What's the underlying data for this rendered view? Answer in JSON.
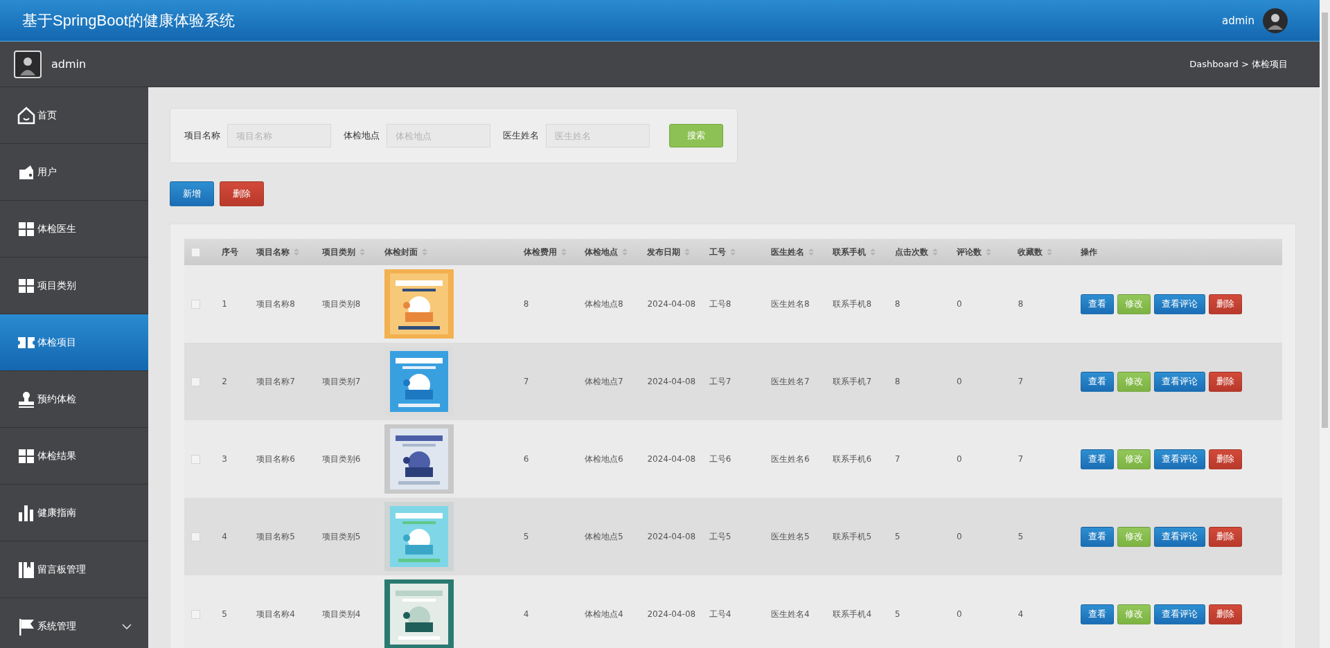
{
  "header": {
    "title": "基于SpringBoot的健康体验系统",
    "user": "admin"
  },
  "subheader": {
    "user": "admin",
    "breadcrumb": "Dashboard > 体检项目"
  },
  "sidebar": {
    "items": [
      {
        "label": "首页",
        "selected": false
      },
      {
        "label": "用户",
        "selected": false
      },
      {
        "label": "体检医生",
        "selected": false
      },
      {
        "label": "项目类别",
        "selected": false
      },
      {
        "label": "体检项目",
        "selected": true
      },
      {
        "label": "预约体检",
        "selected": false
      },
      {
        "label": "体检结果",
        "selected": false
      },
      {
        "label": "健康指南",
        "selected": false
      },
      {
        "label": "留言板管理",
        "selected": false
      },
      {
        "label": "系统管理",
        "selected": false,
        "expanded": false
      }
    ]
  },
  "search": {
    "fields": [
      {
        "label": "项目名称",
        "placeholder": "项目名称"
      },
      {
        "label": "体检地点",
        "placeholder": "体检地点"
      },
      {
        "label": "医生姓名",
        "placeholder": "医生姓名"
      }
    ],
    "button": "搜索"
  },
  "toolbar": [
    {
      "label": "新增",
      "kind": "primary"
    },
    {
      "label": "删除",
      "kind": "danger"
    }
  ],
  "table": {
    "select_all": {
      "checked": false
    },
    "columns": [
      {
        "label": "序号",
        "sortable": false
      },
      {
        "label": "项目名称",
        "sortable": true
      },
      {
        "label": "项目类别",
        "sortable": true
      },
      {
        "label": "体检封面",
        "sortable": true
      },
      {
        "label": "体检费用",
        "sortable": true
      },
      {
        "label": "体检地点",
        "sortable": true
      },
      {
        "label": "发布日期",
        "sortable": true
      },
      {
        "label": "工号",
        "sortable": true
      },
      {
        "label": "医生姓名",
        "sortable": true
      },
      {
        "label": "联系手机",
        "sortable": true
      },
      {
        "label": "点击次数",
        "sortable": true
      },
      {
        "label": "评论数",
        "sortable": true
      },
      {
        "label": "收藏数",
        "sortable": true
      },
      {
        "label": "操作",
        "sortable": false
      }
    ],
    "rows": [
      {
        "checked": false,
        "cells": [
          "1",
          "项目名称8",
          "项目类别8",
          {
            "kind": "picture"
          },
          "8",
          "体检地点8",
          "2024-04-08",
          "工号8",
          "医生姓名8",
          "联系手机8",
          "8",
          "0",
          "8"
        ],
        "actions": [
          {
            "label": "查看",
            "kind": "primary"
          },
          {
            "label": "修改",
            "kind": "success"
          },
          {
            "label": "查看评论",
            "kind": "primary"
          },
          {
            "label": "删除",
            "kind": "danger"
          }
        ]
      },
      {
        "checked": false,
        "cells": [
          "2",
          "项目名称7",
          "项目类别7",
          {
            "kind": "picture"
          },
          "7",
          "体检地点7",
          "2024-04-08",
          "工号7",
          "医生姓名7",
          "联系手机7",
          "8",
          "0",
          "7"
        ],
        "actions": [
          {
            "label": "查看",
            "kind": "primary"
          },
          {
            "label": "修改",
            "kind": "success"
          },
          {
            "label": "查看评论",
            "kind": "primary"
          },
          {
            "label": "删除",
            "kind": "danger"
          }
        ]
      },
      {
        "checked": false,
        "cells": [
          "3",
          "项目名称6",
          "项目类别6",
          {
            "kind": "picture"
          },
          "6",
          "体检地点6",
          "2024-04-08",
          "工号6",
          "医生姓名6",
          "联系手机6",
          "7",
          "0",
          "7"
        ],
        "actions": [
          {
            "label": "查看",
            "kind": "primary"
          },
          {
            "label": "修改",
            "kind": "success"
          },
          {
            "label": "查看评论",
            "kind": "primary"
          },
          {
            "label": "删除",
            "kind": "danger"
          }
        ]
      },
      {
        "checked": false,
        "cells": [
          "4",
          "项目名称5",
          "项目类别5",
          {
            "kind": "picture"
          },
          "5",
          "体检地点5",
          "2024-04-08",
          "工号5",
          "医生姓名5",
          "联系手机5",
          "5",
          "0",
          "5"
        ],
        "actions": [
          {
            "label": "查看",
            "kind": "primary"
          },
          {
            "label": "修改",
            "kind": "success"
          },
          {
            "label": "查看评论",
            "kind": "primary"
          },
          {
            "label": "删除",
            "kind": "danger"
          }
        ]
      },
      {
        "checked": false,
        "cells": [
          "5",
          "项目名称4",
          "项目类别4",
          {
            "kind": "picture"
          },
          "4",
          "体检地点4",
          "2024-04-08",
          "工号4",
          "医生姓名4",
          "联系手机4",
          "5",
          "0",
          "4"
        ],
        "actions": [
          {
            "label": "查看",
            "kind": "primary"
          },
          {
            "label": "修改",
            "kind": "success"
          },
          {
            "label": "查看评论",
            "kind": "primary"
          },
          {
            "label": "删除",
            "kind": "danger"
          }
        ]
      }
    ]
  }
}
